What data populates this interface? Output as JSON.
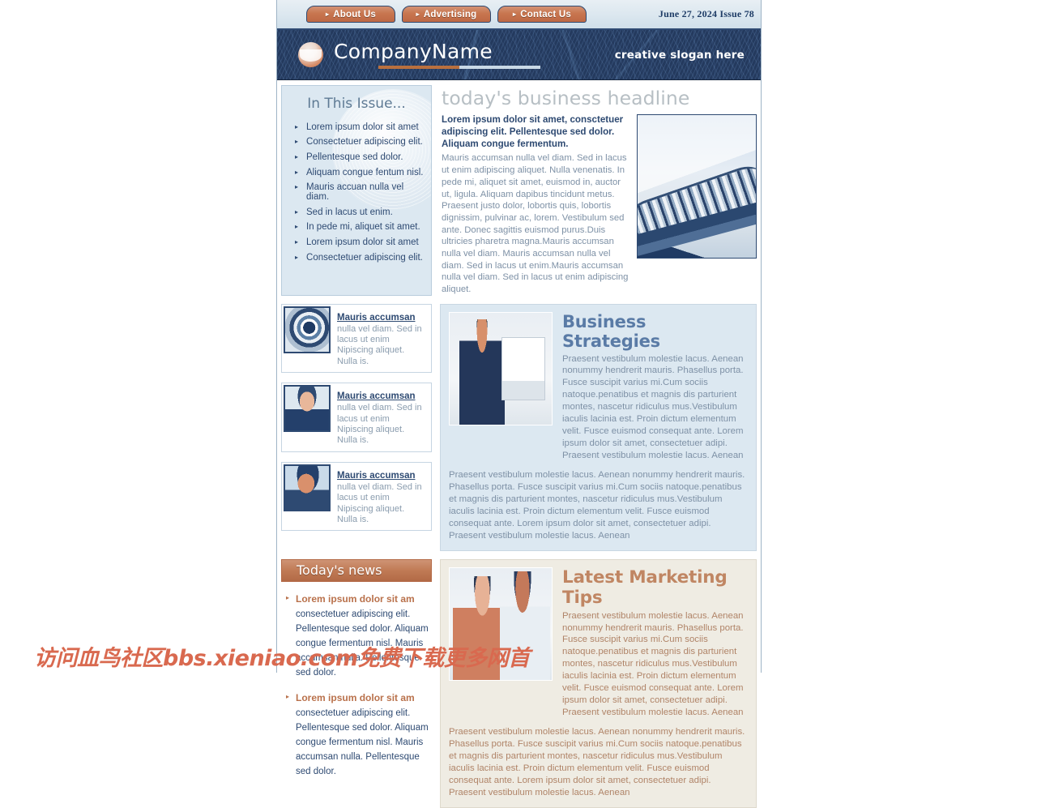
{
  "topnav": {
    "buttons": [
      {
        "label": "About Us",
        "icon": "triangle-right-icon"
      },
      {
        "label": "Advertising",
        "icon": "triangle-right-icon"
      },
      {
        "label": "Contact Us",
        "icon": "triangle-right-icon"
      }
    ],
    "issue_date": "June 27, 2024 Issue 78"
  },
  "banner": {
    "brand": "CompanyName",
    "slogan": "creative slogan here",
    "logo_icon": "circle-globe-logo-icon"
  },
  "issue_box": {
    "title": "In This Issue...",
    "items": [
      "Lorem ipsum dolor sit amet",
      "Consectetuer adipiscing elit.",
      "Pellentesque sed dolor.",
      "Aliquam congue fentum nisl.",
      "Mauris accuan nulla vel diam.",
      "Sed in lacus ut enim.",
      "In pede mi, aliquet sit amet.",
      "Lorem ipsum dolor sit amet",
      "Consectetuer adipiscing elit."
    ]
  },
  "headline": {
    "title": "today's business headline",
    "lead": "Lorem ipsum dolor sit amet, consctetuer adipiscing elit. Pellentesque sed dolor. Aliquam congue fermentum.",
    "body": "Mauris accumsan nulla vel diam. Sed in lacus ut enim adipiscing aliquet. Nulla venenatis. In pede mi, aliquet sit amet, euismod in, auctor ut, ligula. Aliquam dapibus tincidunt metus. Praesent justo dolor, lobortis quis, lobortis dignissim, pulvinar ac, lorem. Vestibulum sed ante. Donec sagittis euismod purus.Duis ultricies pharetra magna.Mauris accumsan nulla vel diam. Mauris accumsan nulla vel diam. Sed in lacus ut enim.Mauris accumsan nulla vel diam. Sed in lacus ut enim adipiscing aliquet.",
    "photo": "spiral-notebook-photo"
  },
  "briefs": [
    {
      "title": "Mauris accumsan",
      "text": "nulla vel diam. Sed in lacus ut enim Nipiscing aliquet. Nulla is.",
      "thumb": "abstract-rings-thumbnail"
    },
    {
      "title": "Mauris accumsan",
      "text": "nulla vel diam. Sed in lacus ut enim Nipiscing aliquet. Nulla is.",
      "thumb": "smiling-woman-thumbnail"
    },
    {
      "title": "Mauris accumsan",
      "text": "nulla vel diam. Sed in lacus ut enim Nipiscing aliquet. Nulla is.",
      "thumb": "man-on-phone-thumbnail"
    }
  ],
  "strategies": {
    "title": "Business Strategies",
    "photo": "presenter-at-flipchart-photo",
    "para": "Praesent vestibulum molestie lacus. Aenean nonummy hendrerit mauris. Phasellus porta. Fusce suscipit varius mi.Cum sociis natoque.penatibus et magnis dis parturient montes, nascetur ridiculus mus.Vestibulum iaculis lacinia est. Proin dictum elementum velit. Fusce euismod consequat ante. Lorem ipsum dolor sit amet, consectetuer adipi. Praesent vestibulum molestie lacus. Aenean",
    "footer": "Praesent vestibulum molestie lacus. Aenean nonummy hendrerit mauris. Phasellus porta. Fusce suscipit varius mi.Cum sociis natoque.penatibus et magnis dis parturient montes, nascetur ridiculus mus.Vestibulum iaculis lacinia est. Proin dictum elementum velit. Fusce euismod consequat ante. Lorem ipsum dolor sit amet, consectetuer adipi. Praesent vestibulum molestie lacus. Aenean"
  },
  "news": {
    "heading": "Today's news",
    "items": [
      {
        "lead": "Lorem ipsum dolor sit am",
        "text": "consectetuer adipiscing elit. Pellentesque sed dolor. Aliquam congue fermentum nisl. Mauris accumsan nulla. Pellentesque sed dolor."
      },
      {
        "lead": "Lorem ipsum dolor sit am",
        "text": "consectetuer adipiscing elit. Pellentesque sed dolor. Aliquam congue fermentum nisl. Mauris accumsan nulla. Pellentesque sed dolor."
      }
    ]
  },
  "marketing": {
    "title": "Latest Marketing Tips",
    "photo": "two-women-reviewing-document-photo",
    "para": "Praesent vestibulum molestie lacus. Aenean nonummy hendrerit mauris. Phasellus porta. Fusce suscipit varius mi.Cum sociis natoque.penatibus et magnis dis parturient montes, nascetur ridiculus mus.Vestibulum iaculis lacinia est. Proin dictum elementum velit. Fusce euismod consequat ante. Lorem ipsum dolor sit amet, consectetuer adipi. Praesent vestibulum molestie lacus. Aenean",
    "footer": "Praesent vestibulum molestie lacus. Aenean nonummy hendrerit mauris. Phasellus porta. Fusce suscipit varius mi.Cum sociis natoque.penatibus et magnis dis parturient montes, nascetur ridiculus mus.Vestibulum iaculis lacinia est. Proin dictum elementum velit. Fusce euismod consequat ante. Lorem ipsum dolor sit amet, consectetuer adipi. Praesent vestibulum molestie lacus. Aenean"
  },
  "watermark": {
    "text": "访问血鸟社区bbs.xieniao.com免费下载更多网首"
  },
  "colors": {
    "navy": "#2e4a72",
    "banner_bg": "#243a5e",
    "accent_orange": "#c0764f",
    "panel_blue": "#dce8f1",
    "panel_warm": "#efece3",
    "body_text": "#7e91a6",
    "watermark": "#d9694f"
  }
}
